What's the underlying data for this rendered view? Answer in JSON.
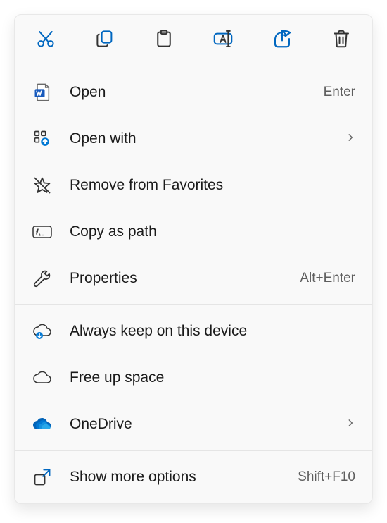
{
  "toolbar": {
    "cut": "Cut",
    "copy": "Copy",
    "paste": "Paste",
    "rename": "Rename",
    "share": "Share",
    "delete": "Delete"
  },
  "menu": {
    "open": {
      "label": "Open",
      "shortcut": "Enter"
    },
    "open_with": {
      "label": "Open with"
    },
    "remove_favorites": {
      "label": "Remove from Favorites"
    },
    "copy_as_path": {
      "label": "Copy as path"
    },
    "properties": {
      "label": "Properties",
      "shortcut": "Alt+Enter"
    },
    "always_keep": {
      "label": "Always keep on this device"
    },
    "free_up_space": {
      "label": "Free up space"
    },
    "onedrive": {
      "label": "OneDrive"
    },
    "show_more": {
      "label": "Show more options",
      "shortcut": "Shift+F10"
    }
  }
}
